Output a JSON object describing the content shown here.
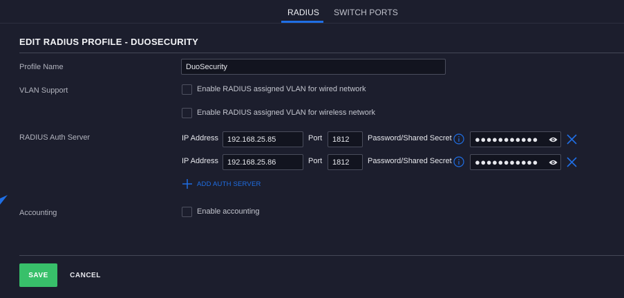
{
  "tabs": [
    {
      "label": "RADIUS",
      "active": true
    },
    {
      "label": "SWITCH PORTS",
      "active": false
    }
  ],
  "title": "EDIT RADIUS PROFILE - DUOSECURITY",
  "profile_name": {
    "label": "Profile Name",
    "value": "DuoSecurity"
  },
  "vlan_support": {
    "label": "VLAN Support",
    "options": [
      {
        "label": "Enable RADIUS assigned VLAN for wired network",
        "checked": false
      },
      {
        "label": "Enable RADIUS assigned VLAN for wireless network",
        "checked": false
      }
    ]
  },
  "auth_server": {
    "label": "RADIUS Auth Server",
    "ip_label": "IP Address",
    "port_label": "Port",
    "secret_label": "Password/Shared Secret",
    "servers": [
      {
        "ip": "192.168.25.85",
        "port": "1812",
        "secret": "●●●●●●●●●●●"
      },
      {
        "ip": "192.168.25.86",
        "port": "1812",
        "secret": "●●●●●●●●●●●"
      }
    ],
    "add_label": "ADD AUTH SERVER"
  },
  "accounting": {
    "label": "Accounting",
    "option_label": "Enable accounting",
    "checked": false
  },
  "footer": {
    "save_label": "SAVE",
    "cancel_label": "CANCEL"
  },
  "colors": {
    "background": "#1c1e2d",
    "accent": "#1f6fe5",
    "save": "#38c06a",
    "input_bg": "#12141f",
    "border": "#4a4d5c"
  },
  "icons": {
    "info": "info-circle-icon",
    "reveal": "eye-icon",
    "remove": "close-x-icon",
    "add": "plus-icon"
  }
}
